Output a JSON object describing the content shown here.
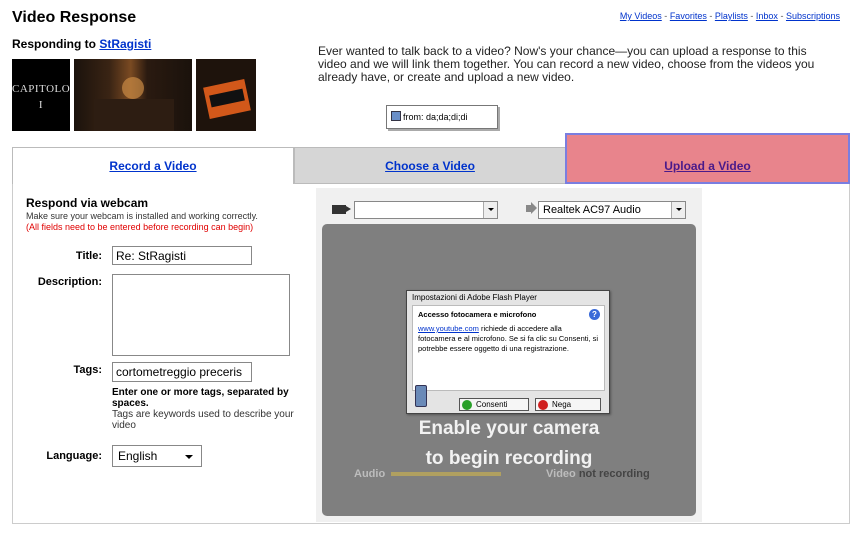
{
  "header": {
    "title": "Video Response",
    "links": [
      "My Videos",
      "Favorites",
      "Playlists",
      "Inbox",
      "Subscriptions"
    ],
    "separator": "-"
  },
  "responding": {
    "label": "Responding to",
    "user": "StRagisti",
    "thumb1_caption_line1": "CAPITOLO",
    "thumb1_caption_line2": "I"
  },
  "intro": {
    "text": "Ever wanted to talk back to a video? Now's your chance—you can upload a response to this video and we will link them together. You can record a new video, choose from the videos you already have, or create and upload a new video.",
    "from_box": "from: da;da;di;di"
  },
  "tabs": {
    "record": "Record a Video",
    "choose": "Choose a Video",
    "upload": "Upload a Video"
  },
  "webcam": {
    "title": "Respond via webcam",
    "note": "Make sure your webcam is installed and working correctly.",
    "warning": "(All fields need to be entered before recording can begin)"
  },
  "form": {
    "title_label": "Title:",
    "title_value": "Re: StRagisti",
    "description_label": "Description:",
    "description_value": "",
    "tags_label": "Tags:",
    "tags_value": "cortometreggio preceris",
    "tags_help_bold": "Enter one or more tags, separated by spaces.",
    "tags_help": "Tags are keywords used to describe your video",
    "language_label": "Language:",
    "language_value": "English"
  },
  "recorder": {
    "camera_value": "",
    "audio_value": "Realtek AC97 Audio",
    "message_line1": "Enable your camera",
    "message_line2": "to begin recording",
    "audio_label": "Audio",
    "video_label": "Video",
    "video_status": "not recording"
  },
  "flash_dialog": {
    "title": "Impostazioni di Adobe Flash Player",
    "heading": "Accesso fotocamera e microfono",
    "site": "www.youtube.com",
    "body": "richiede di accedere alla fotocamera e al microfono. Se si fa clic su Consenti, si potrebbe essere oggetto di una registrazione.",
    "allow": "Consenti",
    "deny": "Nega"
  },
  "colors": {
    "link": "#0033cc",
    "upload_tab_bg": "#e8848c",
    "upload_tab_border": "#7a7ee0",
    "warning": "#e00000"
  }
}
